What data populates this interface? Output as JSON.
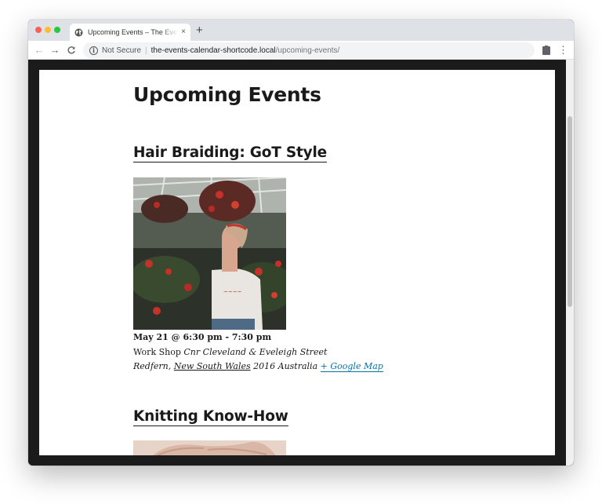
{
  "browser": {
    "tab_title": "Upcoming Events – The Events Calendar Shortcode",
    "tab_close": "×",
    "new_tab": "+",
    "nav_back": "←",
    "nav_forward": "→",
    "nav_reload": "C",
    "security_label": "Not Secure",
    "url_host": "the-events-calendar-shortcode.local",
    "url_path": "/upcoming-events/",
    "menu_glyph": "⋮",
    "traffic_colors": [
      "#fe5f57",
      "#febc2e",
      "#28c840"
    ],
    "icons": [
      "globe-icon",
      "info-icon",
      "clipboard-extension-icon",
      "more-menu-icon"
    ]
  },
  "page": {
    "title": "Upcoming Events",
    "events": [
      {
        "title": "Hair Braiding: GoT Style",
        "datetime": "May 21 @ 6:30 pm - 7:30 pm",
        "venue": "Work Shop",
        "street": "Cnr Cleveland & Eveleigh Street",
        "city": "Redfern,",
        "state": "New South Wales",
        "postcode_country": "2016 Australia",
        "map_link": "+ Google Map",
        "image": "woman-in-greenhouse-photo"
      },
      {
        "title": "Knitting Know-How",
        "image": "knitted-sweater-photo"
      }
    ]
  },
  "colors": {
    "link_blue": "#0073aa",
    "text_dark": "#1a1a1a",
    "theme_frame": "#1b1b1b"
  }
}
